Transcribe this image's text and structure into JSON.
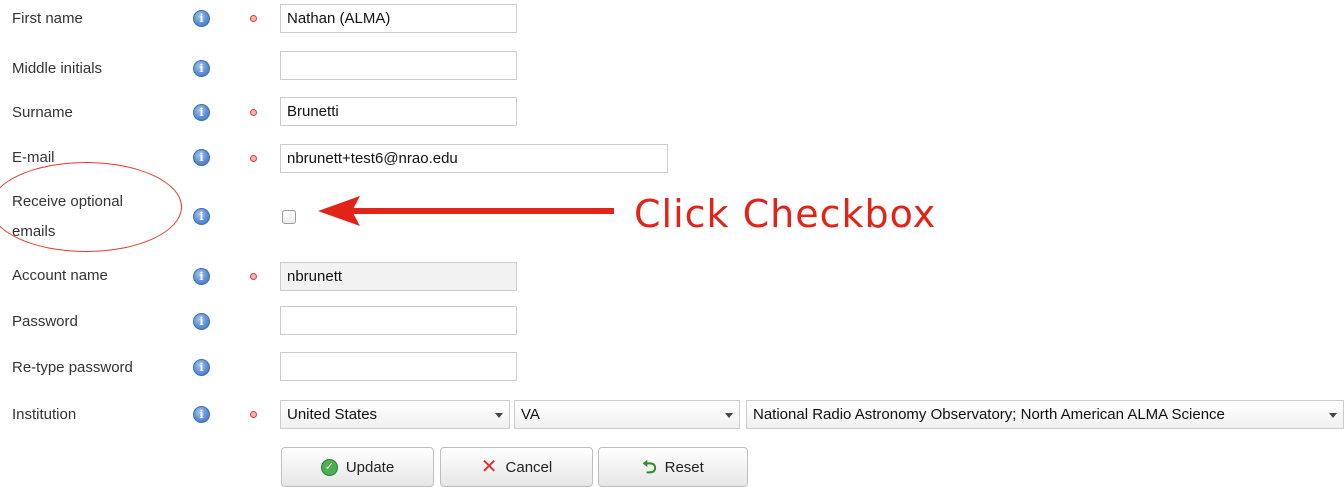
{
  "form": {
    "first_name": {
      "label": "First name",
      "value": "Nathan (ALMA)"
    },
    "middle_initials": {
      "label": "Middle initials",
      "value": ""
    },
    "surname": {
      "label": "Surname",
      "value": "Brunetti"
    },
    "email": {
      "label": "E-mail",
      "value": "nbrunett+test6@nrao.edu"
    },
    "optional_emails": {
      "label_line1": "Receive optional",
      "label_line2": "emails",
      "checked": false
    },
    "account_name": {
      "label": "Account name",
      "value": "nbrunett"
    },
    "password": {
      "label": "Password",
      "value": ""
    },
    "retype_password": {
      "label": "Re-type password",
      "value": ""
    },
    "institution": {
      "label": "Institution",
      "country": "United States",
      "state": "VA",
      "organization": "National Radio Astronomy Observatory; North American ALMA Science"
    }
  },
  "buttons": {
    "update": "Update",
    "cancel": "Cancel",
    "reset": "Reset"
  },
  "annotation": {
    "text": "Click Checkbox",
    "color": "#e22318"
  },
  "icons": {
    "info": "info-icon",
    "required": "required-dot-icon",
    "ok": "check-circle-icon",
    "cancel": "x-icon",
    "reset": "reset-arrow-icon"
  }
}
